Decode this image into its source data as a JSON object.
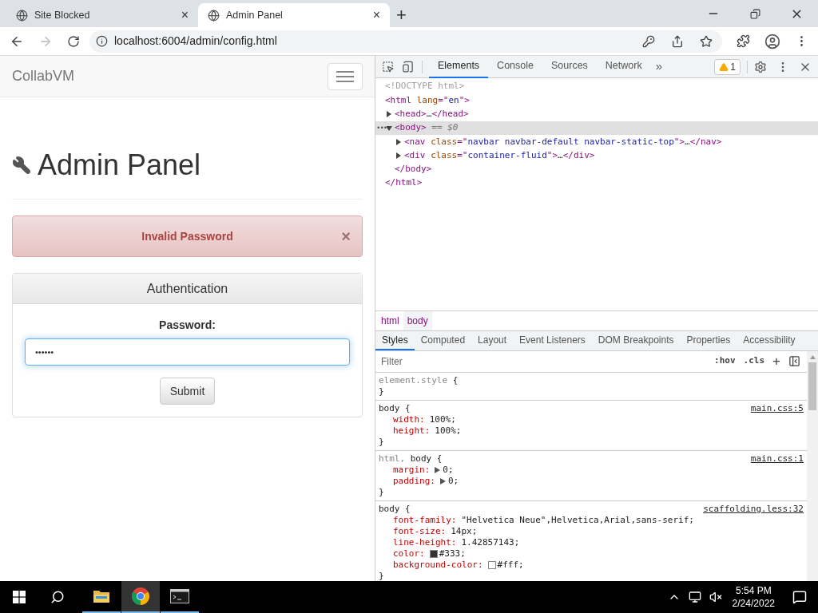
{
  "browser": {
    "tabs": [
      {
        "title": "Site Blocked",
        "selected": false,
        "close": "×"
      },
      {
        "title": "Admin Panel",
        "selected": true,
        "close": "×"
      }
    ],
    "new_tab": "+",
    "address": "localhost:6004/admin/config.html"
  },
  "page": {
    "brand": "CollabVM",
    "heading": "Admin Panel",
    "alert": {
      "text": "Invalid Password",
      "close": "×"
    },
    "panel": {
      "title": "Authentication",
      "label": "Password:",
      "value": "••••••",
      "submit": "Submit"
    }
  },
  "devtools": {
    "tabs": [
      {
        "label": "Elements",
        "selected": true
      },
      {
        "label": "Console",
        "selected": false
      },
      {
        "label": "Sources",
        "selected": false
      },
      {
        "label": "Network",
        "selected": false
      }
    ],
    "more": "»",
    "warnings": "1",
    "selected_marker": "•••",
    "dom": [
      {
        "has_toggle": false,
        "selected": false,
        "open": [
          {
            "text": "<!DOCTYPE html>",
            "kind": "comment"
          }
        ]
      },
      {
        "has_toggle": false,
        "selected": false,
        "open": [
          {
            "text": "<html ",
            "kind": "tag"
          },
          {
            "text": "lang",
            "kind": "attr"
          },
          {
            "text": "=\"",
            "kind": "tag"
          },
          {
            "text": "en",
            "kind": "value"
          },
          {
            "text": "\">",
            "kind": "tag"
          }
        ],
        "children": [
          {
            "has_toggle": true,
            "expanded": false,
            "selected": false,
            "open": [
              {
                "text": "<head>",
                "kind": "tag"
              },
              {
                "text": "…",
                "kind": "plain"
              },
              {
                "text": "</head>",
                "kind": "tag"
              }
            ]
          },
          {
            "has_toggle": true,
            "expanded": true,
            "selected": true,
            "open": [
              {
                "text": "<body>",
                "kind": "tag"
              },
              {
                "text": " == $0",
                "kind": "dim"
              }
            ],
            "children": [
              {
                "has_toggle": true,
                "expanded": false,
                "selected": false,
                "open": [
                  {
                    "text": "<nav ",
                    "kind": "tag"
                  },
                  {
                    "text": "class",
                    "kind": "attr"
                  },
                  {
                    "text": "=\"",
                    "kind": "tag"
                  },
                  {
                    "text": "navbar navbar-default navbar-static-top",
                    "kind": "value"
                  },
                  {
                    "text": "\">",
                    "kind": "tag"
                  },
                  {
                    "text": "…",
                    "kind": "plain"
                  },
                  {
                    "text": "</nav>",
                    "kind": "tag"
                  }
                ]
              },
              {
                "has_toggle": true,
                "expanded": false,
                "selected": false,
                "open": [
                  {
                    "text": "<div ",
                    "kind": "tag"
                  },
                  {
                    "text": "class",
                    "kind": "attr"
                  },
                  {
                    "text": "=\"",
                    "kind": "tag"
                  },
                  {
                    "text": "container-fluid",
                    "kind": "value"
                  },
                  {
                    "text": "\">",
                    "kind": "tag"
                  },
                  {
                    "text": "…",
                    "kind": "plain"
                  },
                  {
                    "text": "</div>",
                    "kind": "tag"
                  }
                ]
              }
            ],
            "close": [
              {
                "text": "</body>",
                "kind": "tag"
              }
            ]
          }
        ],
        "close": [
          {
            "text": "</html>",
            "kind": "tag"
          }
        ]
      }
    ],
    "breadcrumbs": [
      {
        "label": "html",
        "selected": false
      },
      {
        "label": "body",
        "selected": true
      }
    ],
    "subtabs": [
      {
        "label": "Styles",
        "selected": true
      },
      {
        "label": "Computed",
        "selected": false
      },
      {
        "label": "Layout",
        "selected": false
      },
      {
        "label": "Event Listeners",
        "selected": false
      },
      {
        "label": "DOM Breakpoints",
        "selected": false
      },
      {
        "label": "Properties",
        "selected": false
      },
      {
        "label": "Accessibility",
        "selected": false
      }
    ],
    "filter": {
      "placeholder": "Filter",
      "hov": ":hov",
      "cls": ".cls",
      "add": "+"
    },
    "rules": [
      {
        "selector": [
          {
            "text": "element.style",
            "matched": false
          }
        ],
        "open": "{",
        "close": "}"
      },
      {
        "selector": [
          {
            "text": "body",
            "matched": true
          }
        ],
        "open": "{",
        "close": "}",
        "source": "main.css:5",
        "declarations": [
          {
            "name": "width:",
            "value": "100%;",
            "expandable": false
          },
          {
            "name": "height:",
            "value": "100%;",
            "expandable": false
          }
        ]
      },
      {
        "selector": [
          {
            "text": "html,",
            "matched": false
          },
          {
            "text": "body",
            "matched": true
          }
        ],
        "open": "{",
        "close": "}",
        "source": "main.css:1",
        "declarations": [
          {
            "name": "margin:",
            "value": "0;",
            "expandable": true
          },
          {
            "name": "padding:",
            "value": "0;",
            "expandable": true
          }
        ]
      },
      {
        "selector": [
          {
            "text": "body",
            "matched": true
          }
        ],
        "open": "{",
        "close": "}",
        "source": "scaffolding.less:32",
        "declarations": [
          {
            "name": "font-family:",
            "value": "\"Helvetica Neue\",Helvetica,Arial,sans-serif;",
            "expandable": false
          },
          {
            "name": "font-size:",
            "value": "14px;",
            "expandable": false
          },
          {
            "name": "line-height:",
            "value": "1.42857143;",
            "expandable": false
          },
          {
            "name": "color:",
            "value": "#333;",
            "color": "#333333",
            "expandable": false
          },
          {
            "name": "background-color:",
            "value": "#fff;",
            "color": "#ffffff",
            "expandable": false
          }
        ]
      }
    ]
  },
  "taskbar": {
    "apps": [
      {
        "kind": "explorer",
        "selected": false
      },
      {
        "kind": "chrome",
        "selected": true
      },
      {
        "kind": "terminal",
        "selected": false
      }
    ],
    "time": "5:54 PM",
    "date": "2/24/2022"
  }
}
